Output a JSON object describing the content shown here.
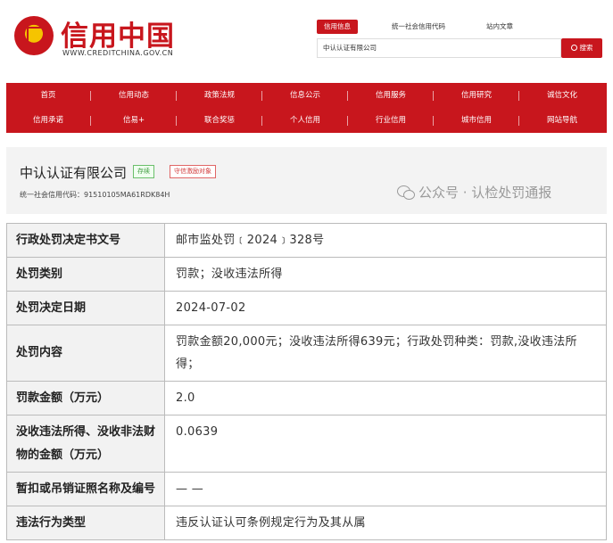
{
  "header": {
    "logo_text": "信用中国",
    "logo_url": "WWW.CREDITCHINA.GOV.CN",
    "search_tabs": [
      "信用信息",
      "统一社会信用代码",
      "站内文章"
    ],
    "search_value": "中认认证有限公司",
    "search_button": "搜索"
  },
  "nav": {
    "row1": [
      "首页",
      "信用动态",
      "政策法规",
      "信息公示",
      "信用服务",
      "信用研究",
      "诚信文化"
    ],
    "row2": [
      "信用承诺",
      "信易+",
      "联合奖惩",
      "个人信用",
      "行业信用",
      "城市信用",
      "网站导航"
    ]
  },
  "company": {
    "name": "中认认证有限公司",
    "status_badge": "存续",
    "incentive_badge": "守信激励对象",
    "credit_code": "统一社会信用代码：91510105MA61RDK84H"
  },
  "watermark": "公众号 · 认检处罚通报",
  "table": {
    "rows": [
      {
        "label": "行政处罚决定书文号",
        "value": "邮市监处罚﹝2024﹞328号"
      },
      {
        "label": "处罚类别",
        "value": "罚款；没收违法所得"
      },
      {
        "label": "处罚决定日期",
        "value": "2024-07-02"
      },
      {
        "label": "处罚内容",
        "value": "罚款金额20,000元；没收违法所得639元；行政处罚种类：罚款,没收违法所得；"
      },
      {
        "label": "罚款金额（万元）",
        "value": "2.0"
      },
      {
        "label": "没收违法所得、没收非法财物的金额（万元）",
        "value": "0.0639"
      },
      {
        "label": "暂扣或吊销证照名称及编号",
        "value": "— —"
      },
      {
        "label": "违法行为类型",
        "value": "违反认证认可条例规定行为及其从属"
      }
    ]
  },
  "colors": {
    "brand_red": "#c8161d",
    "label_bg": "#f2f2f2"
  }
}
